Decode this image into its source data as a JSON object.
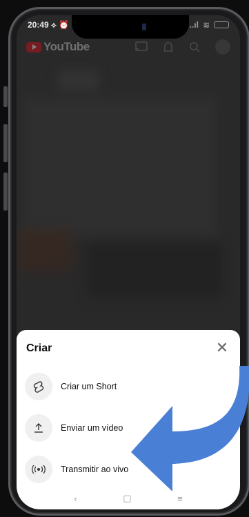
{
  "statusbar": {
    "time": "20:49",
    "left_icons": "⟡ ⏰",
    "signal": "..ıl",
    "wifi": "≋"
  },
  "app": {
    "name": "YouTube"
  },
  "header_icons": [
    "cast-icon",
    "bell-icon",
    "search-icon",
    "avatar"
  ],
  "sheet": {
    "title": "Criar",
    "close_glyph": "✕",
    "options": [
      {
        "label": "Criar um Short",
        "icon": "shorts-icon",
        "glyph": "ʂ"
      },
      {
        "label": "Enviar um vídeo",
        "icon": "upload-icon",
        "glyph": "⇧"
      },
      {
        "label": "Transmitir ao vivo",
        "icon": "live-icon",
        "glyph": "((•))"
      }
    ]
  },
  "navbar": {
    "back": "‹",
    "home": "▢",
    "menu": "≡"
  },
  "colors": {
    "arrow": "#4a7fd6",
    "youtube_red": "#c8242a",
    "sheet_bg": "#ffffff"
  }
}
